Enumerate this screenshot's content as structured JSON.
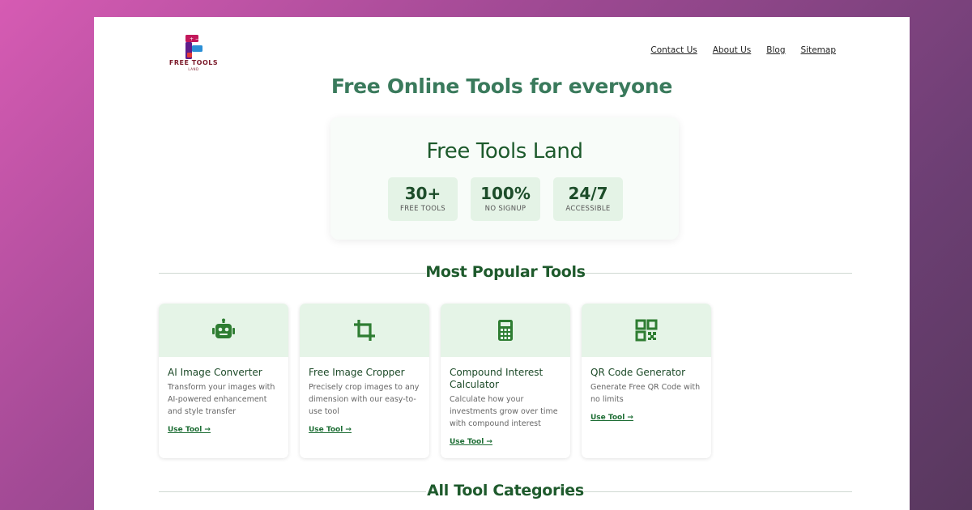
{
  "logo": {
    "text": "FREE TOOLS",
    "sub": "LAND"
  },
  "nav": [
    {
      "label": "Contact Us"
    },
    {
      "label": "About Us"
    },
    {
      "label": "Blog"
    },
    {
      "label": "Sitemap"
    }
  ],
  "hero": {
    "title": "Free Online Tools for everyone"
  },
  "stats": {
    "title": "Free Tools Land",
    "items": [
      {
        "value": "30+",
        "label": "FREE TOOLS"
      },
      {
        "value": "100%",
        "label": "NO SIGNUP"
      },
      {
        "value": "24/7",
        "label": "ACCESSIBLE"
      }
    ]
  },
  "sections": {
    "popular": "Most Popular Tools",
    "categories": "All Tool Categories"
  },
  "tools": [
    {
      "icon": "robot-icon",
      "title": "AI Image Converter",
      "desc": "Transform your images with AI-powered enhancement and style transfer",
      "link": "Use Tool →"
    },
    {
      "icon": "crop-icon",
      "title": "Free Image Cropper",
      "desc": "Precisely crop images to any dimension with our easy-to-use tool",
      "link": "Use Tool →"
    },
    {
      "icon": "calculator-icon",
      "title": "Compound Interest Calculator",
      "desc": "Calculate how your investments grow over time with compound interest",
      "link": "Use Tool  →"
    },
    {
      "icon": "qr-code-icon",
      "title": "QR Code Generator",
      "desc": "Generate Free QR Code with no limits",
      "link": "Use Tool →"
    }
  ],
  "colors": {
    "accent": "#1d5a2c",
    "card_header": "#e5f4e7",
    "logo": "#7b1a2a"
  }
}
